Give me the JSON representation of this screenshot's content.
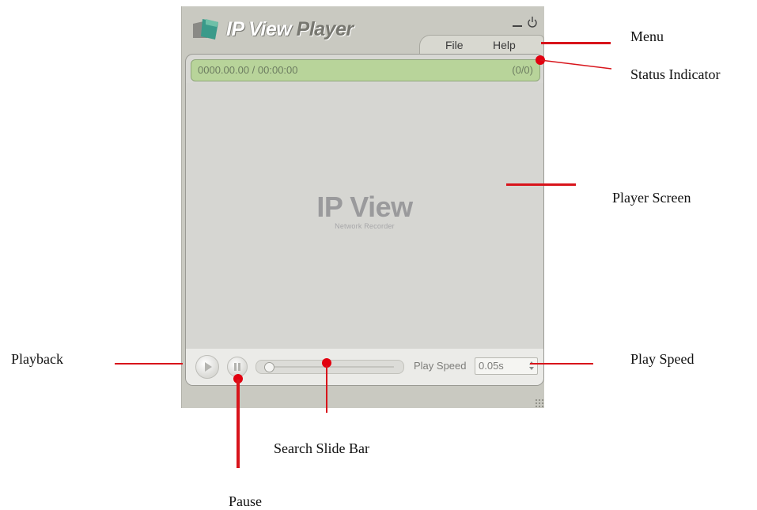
{
  "window": {
    "title_part1": "IP View",
    "title_part2": "Player",
    "menu": {
      "file": "File",
      "help": "Help"
    }
  },
  "status": {
    "time": "0000.00.00 / 00:00:00",
    "count": "(0/0)"
  },
  "screen": {
    "logo_text": "IP View",
    "logo_subtext": "Network Recorder"
  },
  "controls": {
    "speed_label": "Play Speed",
    "speed_value": "0.05s",
    "slider_position": 0.0
  },
  "callouts": {
    "menu": "Menu",
    "status_indicator": "Status Indicator",
    "player_screen": "Player Screen",
    "playback": "Playback",
    "play_speed": "Play Speed",
    "search_slide_bar": "Search Slide Bar",
    "pause": "Pause"
  },
  "colors": {
    "callout_red": "#d8141b",
    "status_green": "#b8d49a",
    "window_gray": "#c9c9c1"
  }
}
